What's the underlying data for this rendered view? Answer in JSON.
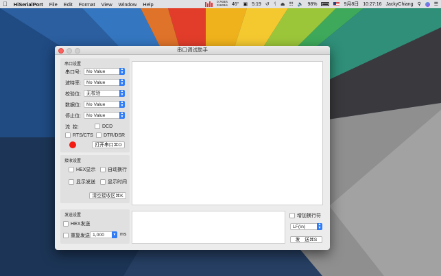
{
  "menubar": {
    "app_name": "HiSerialPort",
    "menus": [
      "File",
      "Edit",
      "Format",
      "View",
      "Window",
      "Help"
    ],
    "net_up": "0.7KB/s",
    "net_down": "3.6KB/s",
    "temperature": "46°",
    "timer": "5:19",
    "battery": "98%",
    "date": "9月8日",
    "time": "10:27:16",
    "user": "JackyChiang"
  },
  "window": {
    "title": "串口调试助手",
    "serial_settings": {
      "group_title": "串口设置",
      "port_label": "串口号:",
      "port_value": "No Value",
      "baud_label": "波特率:",
      "baud_value": "No Value",
      "parity_label": "校验位:",
      "parity_value": "无校验",
      "data_bits_label": "数据位:",
      "data_bits_value": "No Value",
      "stop_bits_label": "停止位:",
      "stop_bits_value": "No Value",
      "flow_label": "流  控:",
      "dcd_label": "DCD",
      "rts_cts_label": "RTS/CTS",
      "dtr_dsr_label": "DTR/DSR",
      "open_port_button": "打开串口⌘O",
      "status_color": "#f31b12"
    },
    "receive_settings": {
      "group_title": "接收设置",
      "hex_display": "HEX显示",
      "auto_newline": "自动换行",
      "show_sent": "显示发送",
      "show_time": "显示时间",
      "clear_button": "清空接收区⌘K"
    },
    "send_settings": {
      "group_title": "发送设置",
      "hex_send": "HEX发送",
      "repeat_send": "重复发送",
      "interval_value": "1,000",
      "interval_unit": "ms"
    },
    "send_panel": {
      "add_newline": "增加换行符",
      "line_ending_value": "LF(\\n)",
      "send_button": "发　送⌘S"
    }
  }
}
